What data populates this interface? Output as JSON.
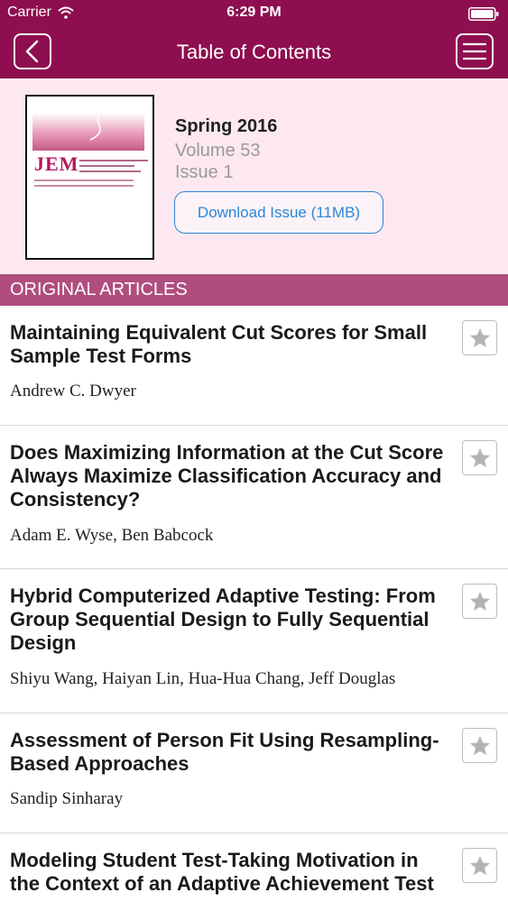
{
  "status_bar": {
    "carrier": "Carrier",
    "time": "6:29 PM"
  },
  "nav": {
    "title": "Table of Contents"
  },
  "issue": {
    "cover_title": "JEM",
    "season": "Spring 2016",
    "volume": "Volume 53",
    "issue": "Issue 1",
    "download_label": "Download Issue (11MB)"
  },
  "section": {
    "title": "ORIGINAL ARTICLES"
  },
  "articles": [
    {
      "title": "Maintaining Equivalent Cut Scores for Small Sample Test Forms",
      "authors": "Andrew C. Dwyer"
    },
    {
      "title": "Does Maximizing Information at the Cut Score Always Maximize Classification Accuracy and Consistency?",
      "authors": "Adam E. Wyse, Ben Babcock"
    },
    {
      "title": "Hybrid Computerized Adaptive Testing: From Group Sequential Design to Fully Sequential Design",
      "authors": "Shiyu Wang, Haiyan Lin, Hua-Hua Chang, Jeff Douglas"
    },
    {
      "title": "Assessment of Person Fit Using Resampling-Based Approaches",
      "authors": "Sandip Sinharay"
    },
    {
      "title": "Modeling Student Test-Taking Motivation in the Context of an Adaptive Achievement Test",
      "authors": ""
    }
  ],
  "colors": {
    "nav": "#8e0e4f",
    "header_bg": "#fde8f1",
    "section": "#b04d7f",
    "link": "#2b86d9"
  },
  "icons": {
    "back": "chevron-left-icon",
    "menu": "hamburger-menu-icon",
    "favorite": "star-icon",
    "wifi": "wifi-icon",
    "battery": "battery-icon"
  }
}
